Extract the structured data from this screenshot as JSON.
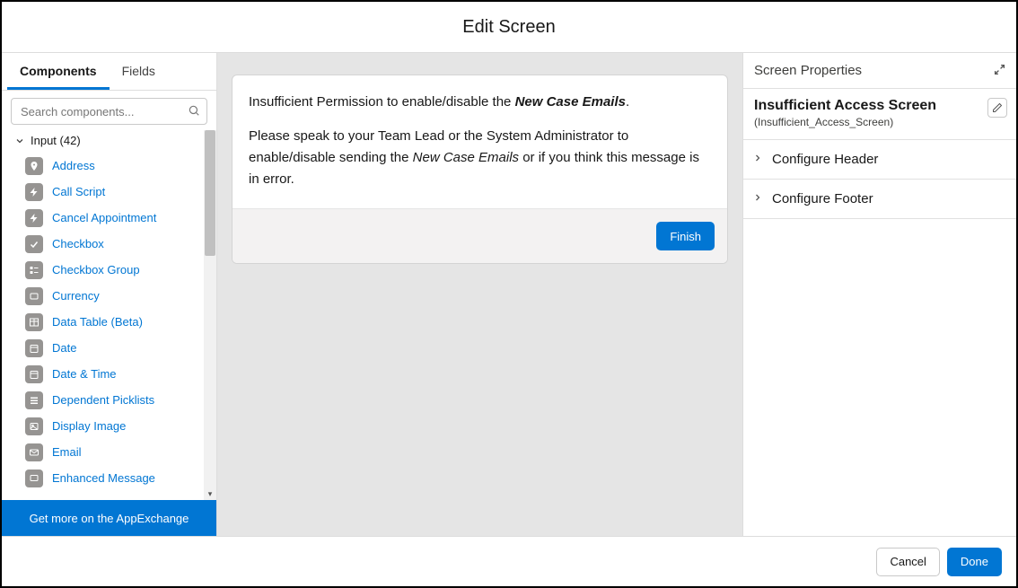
{
  "header": {
    "title": "Edit Screen"
  },
  "left": {
    "tabs": {
      "components": "Components",
      "fields": "Fields"
    },
    "search": {
      "placeholder": "Search components..."
    },
    "group": {
      "label": "Input (42)"
    },
    "items": [
      {
        "label": "Address",
        "key": "address"
      },
      {
        "label": "Call Script",
        "key": "call-script"
      },
      {
        "label": "Cancel Appointment",
        "key": "cancel-appointment"
      },
      {
        "label": "Checkbox",
        "key": "checkbox"
      },
      {
        "label": "Checkbox Group",
        "key": "checkbox-group"
      },
      {
        "label": "Currency",
        "key": "currency"
      },
      {
        "label": "Data Table (Beta)",
        "key": "data-table"
      },
      {
        "label": "Date",
        "key": "date"
      },
      {
        "label": "Date & Time",
        "key": "date-time"
      },
      {
        "label": "Dependent Picklists",
        "key": "dependent-picklists"
      },
      {
        "label": "Display Image",
        "key": "display-image"
      },
      {
        "label": "Email",
        "key": "email"
      },
      {
        "label": "Enhanced Message",
        "key": "enhanced-message"
      }
    ],
    "app_exchange": "Get more on the AppExchange"
  },
  "canvas": {
    "p1a": "Insufficient Permission to enable/disable the ",
    "p1b": "New Case Emails",
    "p1c": ".",
    "p2a": "Please speak to your Team Lead or the System Administrator to enable/disable sending the ",
    "p2b": "New Case Emails",
    "p2c": " or if you think this message is in error.",
    "finish": "Finish"
  },
  "right": {
    "header": "Screen Properties",
    "screen_label": "Insufficient Access Screen",
    "screen_api": "(Insufficient_Access_Screen)",
    "sections": {
      "header": "Configure Header",
      "footer": "Configure Footer"
    }
  },
  "footer": {
    "cancel": "Cancel",
    "done": "Done"
  }
}
